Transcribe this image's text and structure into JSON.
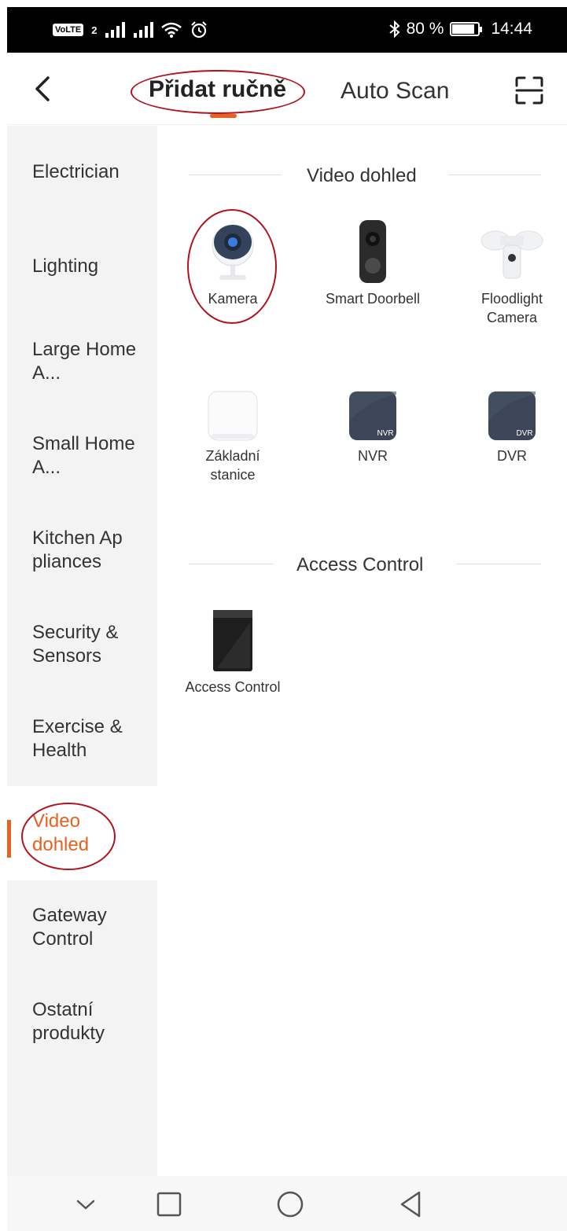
{
  "status_bar": {
    "volte": "VoLTE",
    "sim": "2",
    "battery_text": "80 %",
    "time": "14:44",
    "battery_level": 0.8
  },
  "header": {
    "back_icon": "chevron-left-icon",
    "tab_manual": "Přidat ručně",
    "tab_auto": "Auto Scan",
    "scan_icon": "scan-frame-icon"
  },
  "sidebar": {
    "items": [
      {
        "label": "Electrician"
      },
      {
        "label": "Lighting"
      },
      {
        "label": "Large Home A..."
      },
      {
        "label": "Small Home A..."
      },
      {
        "label": "Kitchen Ap pliances"
      },
      {
        "label": "Security & Sensors"
      },
      {
        "label": "Exercise & Health"
      },
      {
        "label": "Video dohled"
      },
      {
        "label": "Gateway Control"
      },
      {
        "label": "Ostatní produkty"
      }
    ],
    "active_index": 7
  },
  "sections": [
    {
      "title": "Video dohled",
      "devices": [
        {
          "label": "Kamera",
          "icon": "camera-icon"
        },
        {
          "label": "Smart Doorbell",
          "icon": "doorbell-icon"
        },
        {
          "label": "Floodlight Camera",
          "icon": "floodlight-camera-icon"
        },
        {
          "label": "Základní stanice",
          "icon": "base-station-icon"
        },
        {
          "label": "NVR",
          "icon": "nvr-icon",
          "badge": "NVR"
        },
        {
          "label": "DVR",
          "icon": "dvr-icon",
          "badge": "DVR"
        }
      ]
    },
    {
      "title": "Access Control",
      "devices": [
        {
          "label": "Access Control",
          "icon": "access-control-panel-icon"
        }
      ]
    }
  ],
  "colors": {
    "accent": "#e8611e",
    "annotation": "#b3121d",
    "sidebar_bg": "#f3f3f3"
  }
}
